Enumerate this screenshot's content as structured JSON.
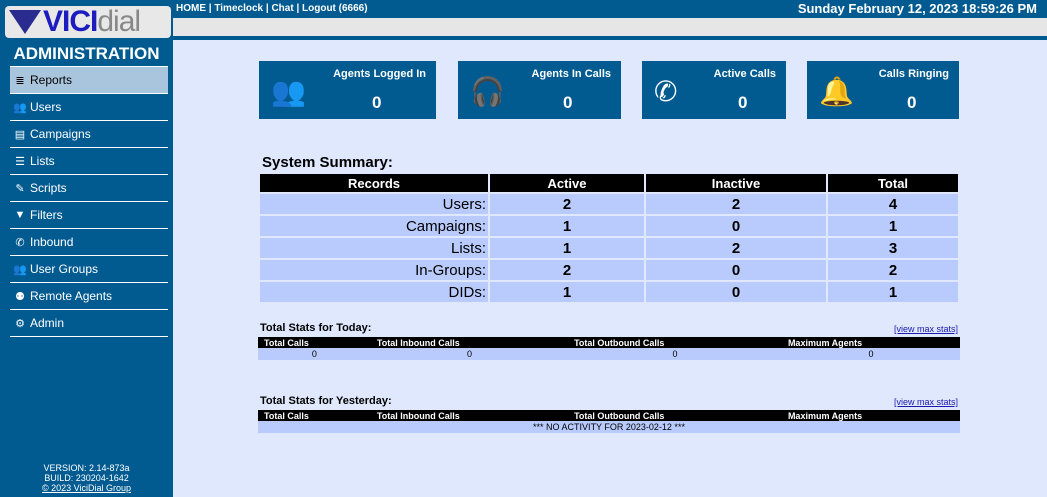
{
  "logo": {
    "text_bold": "VICI",
    "text_light": "dial"
  },
  "sidebar": {
    "title": "ADMINISTRATION",
    "items": [
      {
        "label": "Reports",
        "icon": "reports-icon",
        "glyph": "≣"
      },
      {
        "label": "Users",
        "icon": "users-icon",
        "glyph": "👥"
      },
      {
        "label": "Campaigns",
        "icon": "campaigns-icon",
        "glyph": "▤"
      },
      {
        "label": "Lists",
        "icon": "lists-icon",
        "glyph": "☰"
      },
      {
        "label": "Scripts",
        "icon": "scripts-icon",
        "glyph": "✎"
      },
      {
        "label": "Filters",
        "icon": "filter-icon",
        "glyph": "▼"
      },
      {
        "label": "Inbound",
        "icon": "inbound-icon",
        "glyph": "✆"
      },
      {
        "label": "User Groups",
        "icon": "user-groups-icon",
        "glyph": "👥"
      },
      {
        "label": "Remote Agents",
        "icon": "remote-agents-icon",
        "glyph": "⚉"
      },
      {
        "label": "Admin",
        "icon": "gear-icon",
        "glyph": "⚙"
      }
    ],
    "version": "VERSION: 2.14-873a",
    "build": "BUILD: 230204-1642",
    "copyright": "© 2023 ViciDial Group"
  },
  "topbar": {
    "links": "HOME | Timeclock | Chat | Logout (6666)",
    "datetime": "Sunday February 12, 2023 18:59:26 PM"
  },
  "cards": [
    {
      "label": "Agents Logged In",
      "value": "0",
      "icon": "users-icon"
    },
    {
      "label": "Agents In Calls",
      "value": "0",
      "icon": "headset-agents-icon"
    },
    {
      "label": "Active Calls",
      "value": "0",
      "icon": "phone-icon"
    },
    {
      "label": "Calls Ringing",
      "value": "0",
      "icon": "bell-icon"
    }
  ],
  "summary": {
    "title": "System Summary:",
    "headers": [
      "Records",
      "Active",
      "Inactive",
      "Total"
    ],
    "rows": [
      [
        "Users:",
        "2",
        "2",
        "4"
      ],
      [
        "Campaigns:",
        "1",
        "0",
        "1"
      ],
      [
        "Lists:",
        "1",
        "2",
        "3"
      ],
      [
        "In-Groups:",
        "2",
        "0",
        "2"
      ],
      [
        "DIDs:",
        "1",
        "0",
        "1"
      ]
    ]
  },
  "today": {
    "title": "Total Stats for Today:",
    "link": "[view max stats]",
    "headers": [
      "Total Calls",
      "Total Inbound Calls",
      "Total Outbound Calls",
      "Maximum Agents"
    ],
    "values": [
      "0",
      "0",
      "0",
      "0"
    ]
  },
  "yesterday": {
    "title": "Total Stats for Yesterday:",
    "link": "[view max stats]",
    "headers": [
      "Total Calls",
      "Total Inbound Calls",
      "Total Outbound Calls",
      "Maximum Agents"
    ],
    "message": "*** NO ACTIVITY FOR 2023-02-12 ***"
  }
}
